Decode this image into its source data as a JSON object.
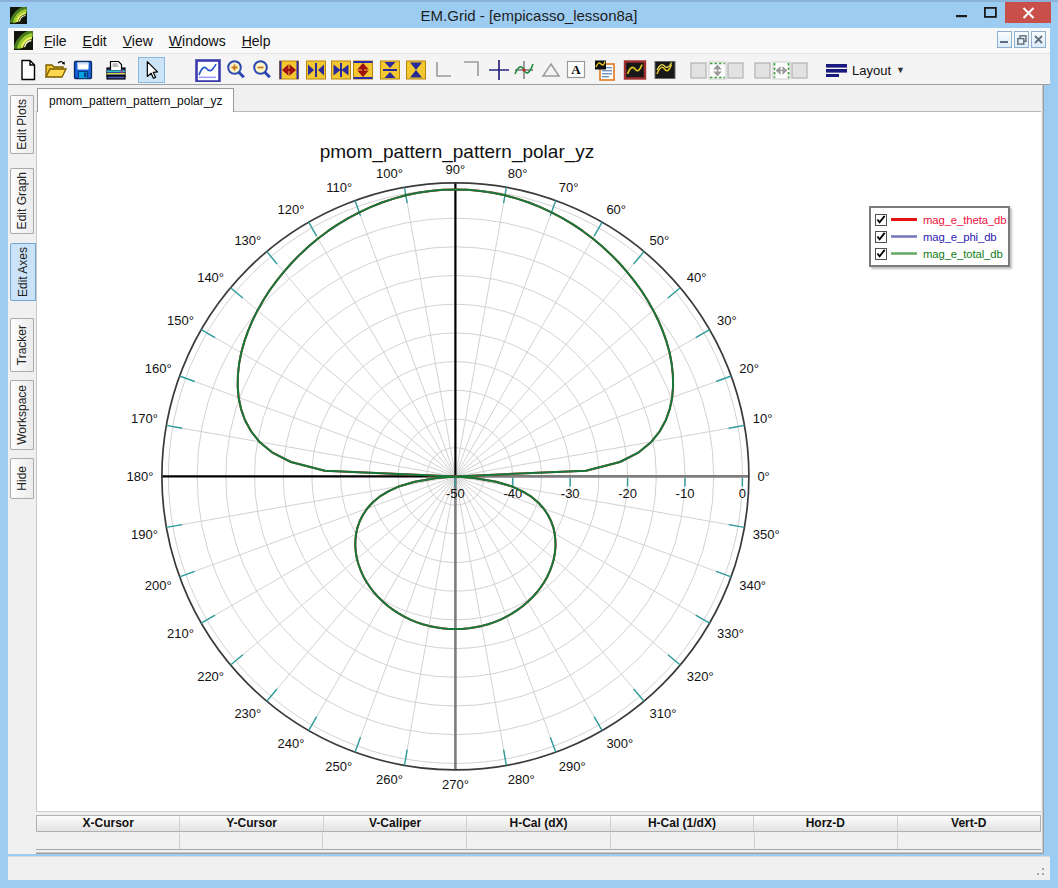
{
  "window": {
    "title": "EM.Grid - [empicasso_lesson8a]",
    "controls": {
      "minimize": "minimize",
      "maximize": "maximize",
      "close": "close"
    }
  },
  "menu": {
    "items": [
      "File",
      "Edit",
      "View",
      "Windows",
      "Help"
    ]
  },
  "mdi_controls": [
    "minimize",
    "restore",
    "close"
  ],
  "toolbar": {
    "icons": [
      "new-document",
      "open-file",
      "save",
      "print",
      "select-cursor",
      "plot-frame",
      "zoom-in",
      "zoom-out",
      "fit-horizontal",
      "expand-horizontal",
      "shrink-horizontal",
      "fit-vertical",
      "expand-vertical",
      "shrink-vertical",
      "corner-bottom-left",
      "corner-top-right",
      "crosshair",
      "tracker-curve",
      "triangle",
      "text-label",
      "copy-plot",
      "plot-style-red-frame",
      "plot-style-dark",
      "disabled-box",
      "expand-y-disabled",
      "disabled-box",
      "disabled-box",
      "expand-x-disabled",
      "disabled-box"
    ],
    "layout_button": {
      "label": "Layout"
    }
  },
  "sidebar": {
    "tabs": [
      {
        "label": "Edit Plots",
        "active": false
      },
      {
        "label": "Edit Graph",
        "active": false
      },
      {
        "label": "Edit Axes",
        "active": true
      },
      {
        "label": "Tracker",
        "active": false
      },
      {
        "label": "Workspace",
        "active": false
      },
      {
        "label": "Hide",
        "active": false
      }
    ]
  },
  "document_tabs": {
    "active": "pmom_pattern_pattern_polar_yz"
  },
  "legend": {
    "items": [
      {
        "label": "mag_e_theta_db",
        "checked": true,
        "line_color": "#e81111",
        "text_color": "#f2123e",
        "line_width": 3
      },
      {
        "label": "mag_e_phi_db",
        "checked": true,
        "line_color": "#7273ba",
        "text_color": "#2b22b4",
        "line_width": 2.5
      },
      {
        "label": "mag_e_total_db",
        "checked": true,
        "line_color": "#63a963",
        "text_color": "#107c16",
        "line_width": 2.5
      }
    ]
  },
  "footer": {
    "columns": [
      "X-Cursor",
      "Y-Cursor",
      "V-Caliper",
      "H-Cal (dX)",
      "H-Cal (1/dX)",
      "Horz-D",
      "Vert-D"
    ],
    "values": [
      "",
      "",
      "",
      "",
      "",
      "",
      ""
    ]
  },
  "chart_data": {
    "type": "polar",
    "title": "pmom_pattern_pattern_polar_yz",
    "angle_unit": "deg",
    "angle_tick_step": 10,
    "angle_labels": [
      "0°",
      "10°",
      "20°",
      "30°",
      "40°",
      "50°",
      "60°",
      "70°",
      "80°",
      "90°",
      "100°",
      "110°",
      "120°",
      "130°",
      "140°",
      "150°",
      "160°",
      "170°",
      "180°",
      "190°",
      "200°",
      "210°",
      "220°",
      "230°",
      "240°",
      "250°",
      "260°",
      "270°",
      "280°",
      "290°",
      "300°",
      "310°",
      "320°",
      "330°",
      "340°",
      "350°"
    ],
    "radial_axis": {
      "min": -50,
      "max": 0,
      "major_step": 10,
      "minor_step": 5,
      "tick_labels": [
        "-50",
        "-40",
        "-30",
        "-20",
        "-10",
        "0"
      ]
    },
    "angles_deg": [
      0.0,
      2.5,
      5.0,
      7.5,
      10.0,
      12.5,
      15.0,
      17.5,
      20.0,
      22.5,
      25.0,
      27.5,
      30.0,
      32.5,
      35.0,
      37.5,
      40.0,
      42.5,
      45.0,
      47.5,
      50.0,
      52.5,
      55.0,
      57.5,
      60.0,
      62.5,
      65.0,
      67.5,
      70.0,
      72.5,
      75.0,
      77.5,
      80.0,
      82.5,
      85.0,
      87.5,
      90.0,
      92.5,
      95.0,
      97.5,
      100.0,
      102.5,
      105.0,
      107.5,
      110.0,
      112.5,
      115.0,
      117.5,
      120.0,
      122.5,
      125.0,
      127.5,
      130.0,
      132.5,
      135.0,
      137.5,
      140.0,
      142.5,
      145.0,
      147.5,
      150.0,
      152.5,
      155.0,
      157.5,
      160.0,
      162.5,
      165.0,
      167.5,
      170.0,
      172.5,
      175.0,
      177.5,
      180.0,
      182.5,
      185.0,
      187.5,
      190.0,
      192.5,
      195.0,
      197.5,
      200.0,
      202.5,
      205.0,
      207.5,
      210.0,
      212.5,
      215.0,
      217.5,
      220.0,
      222.5,
      225.0,
      227.5,
      230.0,
      232.5,
      235.0,
      237.5,
      240.0,
      242.5,
      245.0,
      247.5,
      250.0,
      252.5,
      255.0,
      257.5,
      260.0,
      262.5,
      265.0,
      267.5,
      270.0,
      272.5,
      275.0,
      277.5,
      280.0,
      282.5,
      285.0,
      287.5,
      290.0,
      292.5,
      295.0,
      297.5,
      300.0,
      302.5,
      305.0,
      307.5,
      310.0,
      312.5,
      315.0,
      317.5,
      320.0,
      322.5,
      325.0,
      327.5,
      330.0,
      332.5,
      335.0,
      337.5,
      340.0,
      342.5,
      345.0,
      347.5,
      350.0,
      352.5,
      355.0,
      357.5,
      360.0
    ],
    "series": [
      {
        "name": "mag_e_theta_db",
        "color": "#cc2020",
        "values": [
          -50.0,
          -27.22,
          -21.23,
          -17.77,
          -15.35,
          -13.51,
          -12.04,
          -10.83,
          -9.81,
          -8.94,
          -8.19,
          -7.52,
          -6.92,
          -6.38,
          -5.89,
          -5.43,
          -5.0,
          -4.6,
          -4.21,
          -3.84,
          -3.48,
          -3.13,
          -2.79,
          -2.47,
          -2.15,
          -1.85,
          -1.56,
          -1.29,
          -1.04,
          -0.81,
          -0.6,
          -0.42,
          -0.27,
          -0.16,
          -0.07,
          -0.02,
          0.0,
          -0.02,
          -0.07,
          -0.16,
          -0.27,
          -0.42,
          -0.6,
          -0.81,
          -1.04,
          -1.29,
          -1.56,
          -1.85,
          -2.15,
          -2.47,
          -2.79,
          -3.13,
          -3.48,
          -3.84,
          -4.21,
          -4.6,
          -5.0,
          -5.43,
          -5.89,
          -6.38,
          -6.92,
          -7.52,
          -8.19,
          -8.94,
          -9.81,
          -10.83,
          -12.04,
          -13.51,
          -15.35,
          -17.77,
          -21.23,
          -27.22,
          -50.0,
          -50.0,
          -46.71,
          -42.85,
          -40.13,
          -38.02,
          -36.31,
          -34.88,
          -33.65,
          -32.58,
          -31.63,
          -30.78,
          -30.02,
          -29.34,
          -28.71,
          -28.14,
          -27.62,
          -27.15,
          -26.71,
          -26.31,
          -25.95,
          -25.61,
          -25.31,
          -25.03,
          -24.77,
          -24.55,
          -24.34,
          -24.16,
          -23.99,
          -23.85,
          -23.73,
          -23.63,
          -23.55,
          -23.48,
          -23.44,
          -23.41,
          -23.4,
          -23.41,
          -23.44,
          -23.48,
          -23.55,
          -23.63,
          -23.73,
          -23.85,
          -23.99,
          -24.16,
          -24.34,
          -24.55,
          -24.77,
          -25.03,
          -25.31,
          -25.61,
          -25.95,
          -26.31,
          -26.71,
          -27.15,
          -27.62,
          -28.14,
          -28.71,
          -29.34,
          -30.02,
          -30.78,
          -31.63,
          -32.58,
          -33.65,
          -34.88,
          -36.31,
          -38.02,
          -40.13,
          -42.85,
          -46.71,
          -50.0,
          -50.0
        ]
      },
      {
        "name": "mag_e_phi_db",
        "color": "#7273ba",
        "values": [
          -50.0,
          -50.0,
          -50.0,
          -50.0,
          -50.0,
          -50.0,
          -50.0,
          -50.0,
          -50.0,
          -50.0,
          -50.0,
          -50.0,
          -50.0,
          -50.0,
          -50.0,
          -50.0,
          -50.0,
          -50.0,
          -50.0,
          -50.0,
          -50.0,
          -50.0,
          -50.0,
          -50.0,
          -50.0,
          -50.0,
          -50.0,
          -50.0,
          -50.0,
          -50.0,
          -50.0,
          -50.0,
          -50.0,
          -50.0,
          -50.0,
          -50.0,
          -50.0,
          -50.0,
          -50.0,
          -50.0,
          -50.0,
          -50.0,
          -50.0,
          -50.0,
          -50.0,
          -50.0,
          -50.0,
          -50.0,
          -50.0,
          -50.0,
          -50.0,
          -50.0,
          -50.0,
          -50.0,
          -50.0,
          -50.0,
          -50.0,
          -50.0,
          -50.0,
          -50.0,
          -50.0,
          -50.0,
          -50.0,
          -50.0,
          -50.0,
          -50.0,
          -50.0,
          -50.0,
          -50.0,
          -50.0,
          -50.0,
          -50.0,
          -50.0,
          -50.0,
          -50.0,
          -50.0,
          -50.0,
          -50.0,
          -50.0,
          -50.0,
          -50.0,
          -50.0,
          -50.0,
          -50.0,
          -50.0,
          -50.0,
          -50.0,
          -50.0,
          -50.0,
          -50.0,
          -50.0,
          -50.0,
          -50.0,
          -50.0,
          -50.0,
          -50.0,
          -50.0,
          -50.0,
          -50.0,
          -50.0,
          -50.0,
          -50.0,
          -50.0,
          -50.0,
          -50.0,
          -50.0,
          -50.0,
          -50.0,
          -50.0,
          -50.0,
          -50.0,
          -50.0,
          -50.0,
          -50.0,
          -50.0,
          -50.0,
          -50.0,
          -50.0,
          -50.0,
          -50.0,
          -50.0,
          -50.0,
          -50.0,
          -50.0,
          -50.0,
          -50.0,
          -50.0,
          -50.0,
          -50.0,
          -50.0,
          -50.0,
          -50.0,
          -50.0,
          -50.0,
          -50.0,
          -50.0,
          -50.0,
          -50.0,
          -50.0,
          -50.0,
          -50.0,
          -50.0,
          -50.0,
          -50.0,
          -50.0
        ]
      },
      {
        "name": "mag_e_total_db",
        "color": "#15793a",
        "values": [
          -50.0,
          -27.22,
          -21.23,
          -17.77,
          -15.35,
          -13.51,
          -12.04,
          -10.83,
          -9.81,
          -8.94,
          -8.19,
          -7.52,
          -6.92,
          -6.38,
          -5.89,
          -5.43,
          -5.0,
          -4.6,
          -4.21,
          -3.84,
          -3.48,
          -3.13,
          -2.79,
          -2.47,
          -2.15,
          -1.85,
          -1.56,
          -1.29,
          -1.04,
          -0.81,
          -0.6,
          -0.42,
          -0.27,
          -0.16,
          -0.07,
          -0.02,
          0.0,
          -0.02,
          -0.07,
          -0.16,
          -0.27,
          -0.42,
          -0.6,
          -0.81,
          -1.04,
          -1.29,
          -1.56,
          -1.85,
          -2.15,
          -2.47,
          -2.79,
          -3.13,
          -3.48,
          -3.84,
          -4.21,
          -4.6,
          -5.0,
          -5.43,
          -5.89,
          -6.38,
          -6.92,
          -7.52,
          -8.19,
          -8.94,
          -9.81,
          -10.83,
          -12.04,
          -13.51,
          -15.35,
          -17.77,
          -21.23,
          -27.22,
          -50.0,
          -50.0,
          -46.71,
          -42.85,
          -40.13,
          -38.02,
          -36.31,
          -34.88,
          -33.65,
          -32.58,
          -31.63,
          -30.78,
          -30.02,
          -29.34,
          -28.71,
          -28.14,
          -27.62,
          -27.15,
          -26.71,
          -26.31,
          -25.95,
          -25.61,
          -25.31,
          -25.03,
          -24.77,
          -24.55,
          -24.34,
          -24.16,
          -23.99,
          -23.85,
          -23.73,
          -23.63,
          -23.55,
          -23.48,
          -23.44,
          -23.41,
          -23.4,
          -23.41,
          -23.44,
          -23.48,
          -23.55,
          -23.63,
          -23.73,
          -23.85,
          -23.99,
          -24.16,
          -24.34,
          -24.55,
          -24.77,
          -25.03,
          -25.31,
          -25.61,
          -25.95,
          -26.31,
          -26.71,
          -27.15,
          -27.62,
          -28.14,
          -28.71,
          -29.34,
          -30.02,
          -30.78,
          -31.63,
          -32.58,
          -33.65,
          -34.88,
          -36.31,
          -38.02,
          -40.13,
          -42.85,
          -46.71,
          -50.0,
          -50.0
        ]
      }
    ],
    "grid": true,
    "legend_position": "right"
  }
}
